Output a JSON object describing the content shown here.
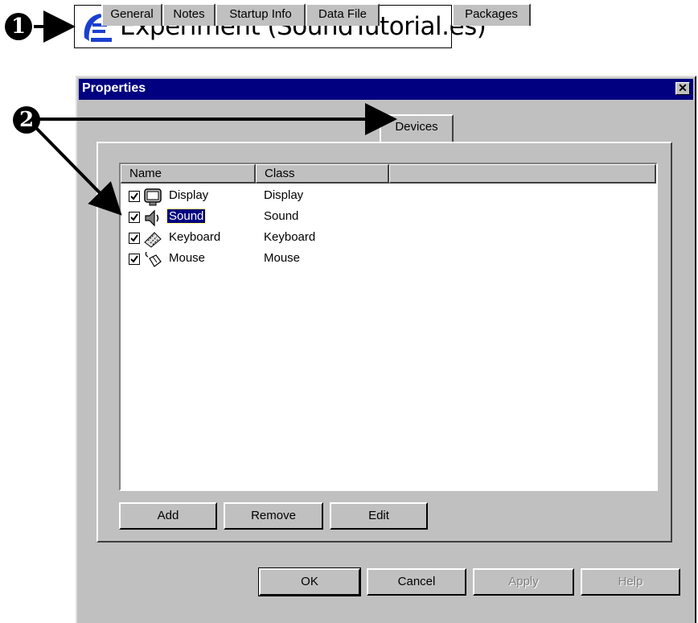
{
  "callouts": [
    {
      "number": "1"
    },
    {
      "number": "2"
    }
  ],
  "tree_node": {
    "label": "Experiment (SoundTutorial.es)",
    "icon": "experiment-icon"
  },
  "dialog": {
    "title": "Properties",
    "close_glyph": "✕",
    "tabs": [
      {
        "label": "General",
        "active": false
      },
      {
        "label": "Notes",
        "active": false
      },
      {
        "label": "Startup Info",
        "active": false
      },
      {
        "label": "Data File",
        "active": false
      },
      {
        "label": "Devices",
        "active": true
      },
      {
        "label": "Packages",
        "active": false
      }
    ],
    "list": {
      "columns": [
        "Name",
        "Class"
      ],
      "rows": [
        {
          "name": "Display",
          "class": "Display",
          "checked": true,
          "icon": "monitor-icon",
          "selected": false
        },
        {
          "name": "Sound",
          "class": "Sound",
          "checked": true,
          "icon": "speaker-icon",
          "selected": true
        },
        {
          "name": "Keyboard",
          "class": "Keyboard",
          "checked": true,
          "icon": "keyboard-icon",
          "selected": false
        },
        {
          "name": "Mouse",
          "class": "Mouse",
          "checked": true,
          "icon": "mouse-icon",
          "selected": false
        }
      ]
    },
    "panel_buttons": {
      "add": "Add",
      "remove": "Remove",
      "edit": "Edit"
    },
    "footer_buttons": {
      "ok": "OK",
      "cancel": "Cancel",
      "apply": "Apply",
      "help": "Help"
    }
  },
  "colors": {
    "title_bar": "#000080",
    "face": "#c0c0c0",
    "selection": "#000080"
  }
}
